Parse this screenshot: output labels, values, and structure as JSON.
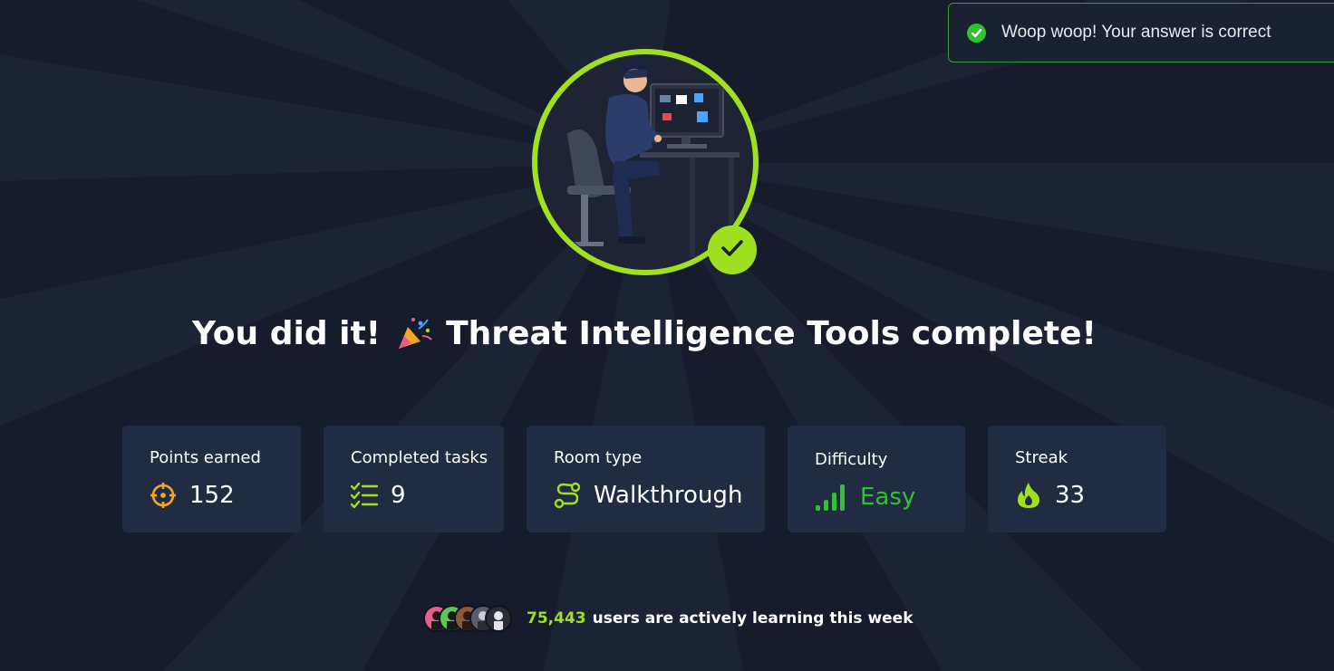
{
  "toast": {
    "message": "Woop woop! Your answer is correct",
    "icon": "check-circle-icon",
    "color": "#2fc231"
  },
  "hero": {
    "illustration": "analyst-at-computer-illustration",
    "ring_color": "#9fe020",
    "badge_icon": "check-icon"
  },
  "heading": {
    "before": "You did it!",
    "emoji": "party-popper-icon",
    "after": "Threat Intelligence Tools complete!"
  },
  "stats": [
    {
      "label": "Points earned",
      "value": "152",
      "icon": "crosshair-icon",
      "icon_color": "#f5a623"
    },
    {
      "label": "Completed tasks",
      "value": "9",
      "icon": "checklist-icon",
      "icon_color": "#9fe020"
    },
    {
      "label": "Room type",
      "value": "Walkthrough",
      "icon": "route-icon",
      "icon_color": "#9fe020"
    },
    {
      "label": "Difficulty",
      "value": "Easy",
      "icon": "signal-bars-icon",
      "icon_color": "#2fc231"
    },
    {
      "label": "Streak",
      "value": "33",
      "icon": "flame-icon",
      "icon_color": "#9fe020"
    }
  ],
  "footer": {
    "count": "75,443",
    "text": "users are actively learning this week",
    "avatar_count": 5
  },
  "colors": {
    "background": "#161c2b",
    "card": "#212c42",
    "accent": "#9fe020"
  }
}
